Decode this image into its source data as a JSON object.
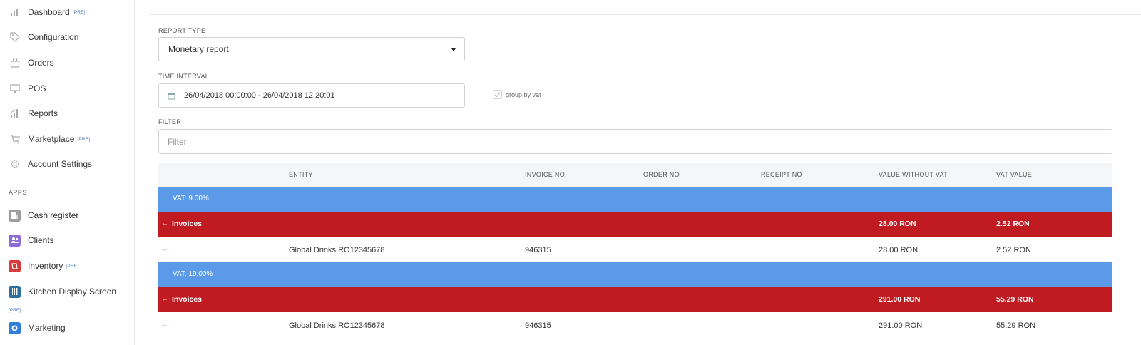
{
  "sidebar": {
    "items": [
      {
        "label": "Dashboard",
        "pre": "[PRE]",
        "icon": "bar-chart-icon"
      },
      {
        "label": "Configuration",
        "pre": "",
        "icon": "tag-icon"
      },
      {
        "label": "Orders",
        "pre": "",
        "icon": "bag-icon"
      },
      {
        "label": "POS",
        "pre": "",
        "icon": "monitor-icon"
      },
      {
        "label": "Reports",
        "pre": "",
        "icon": "reports-icon"
      },
      {
        "label": "Marketplace",
        "pre": "[PRE]",
        "icon": "cart-icon"
      },
      {
        "label": "Account Settings",
        "pre": "",
        "icon": "gear-icon"
      }
    ],
    "apps_section": "APPS",
    "apps": [
      {
        "label": "Cash register",
        "pre": "",
        "icon": "cash-register-icon",
        "color": "#9e9e9e"
      },
      {
        "label": "Clients",
        "pre": "",
        "icon": "clients-icon",
        "color": "#8e6cd6"
      },
      {
        "label": "Inventory",
        "pre": "[PRE]",
        "icon": "inventory-icon",
        "color": "#d63b3b"
      },
      {
        "label": "Kitchen Display Screen",
        "pre": "[PRE]",
        "icon": "kitchen-icon",
        "color": "#2b6f9e"
      },
      {
        "label": "Marketing",
        "pre": "",
        "icon": "marketing-icon",
        "color": "#2f7fd8"
      }
    ]
  },
  "form": {
    "report_type_label": "REPORT TYPE",
    "report_type_value": "Monetary report",
    "time_interval_label": "TIME INTERVAL",
    "time_interval_value": "26/04/2018 00:00:00 - 26/04/2018 12:20:01",
    "group_by_vat_label": "group by vat",
    "filter_label": "FILTER",
    "filter_placeholder": "Filter"
  },
  "table": {
    "headers": {
      "entity": "ENTITY",
      "invoice_no": "INVOICE NO.",
      "order_no": "ORDER NO",
      "receipt_no": "RECEIPT NO",
      "value_without_vat": "VALUE WITHOUT VAT",
      "vat_value": "VAT VALUE"
    },
    "groups": [
      {
        "vat_label": "VAT: 9.00%",
        "invoices_label": "Invoices",
        "invoices_value": "28.00 RON",
        "invoices_vat": "2.52 RON",
        "row": {
          "entity": "Global Drinks RO12345678",
          "invoice_no": "946315",
          "value": "28.00 RON",
          "vat": "2.52 RON"
        }
      },
      {
        "vat_label": "VAT: 19.00%",
        "invoices_label": "Invoices",
        "invoices_value": "291.00 RON",
        "invoices_vat": "55.29 RON",
        "row": {
          "entity": "Global Drinks RO12345678",
          "invoice_no": "946315",
          "value": "291.00 RON",
          "vat": "55.29 RON"
        }
      }
    ]
  },
  "colors": {
    "vat_row": "#5b9ae8",
    "invoice_row": "#c11b22"
  }
}
